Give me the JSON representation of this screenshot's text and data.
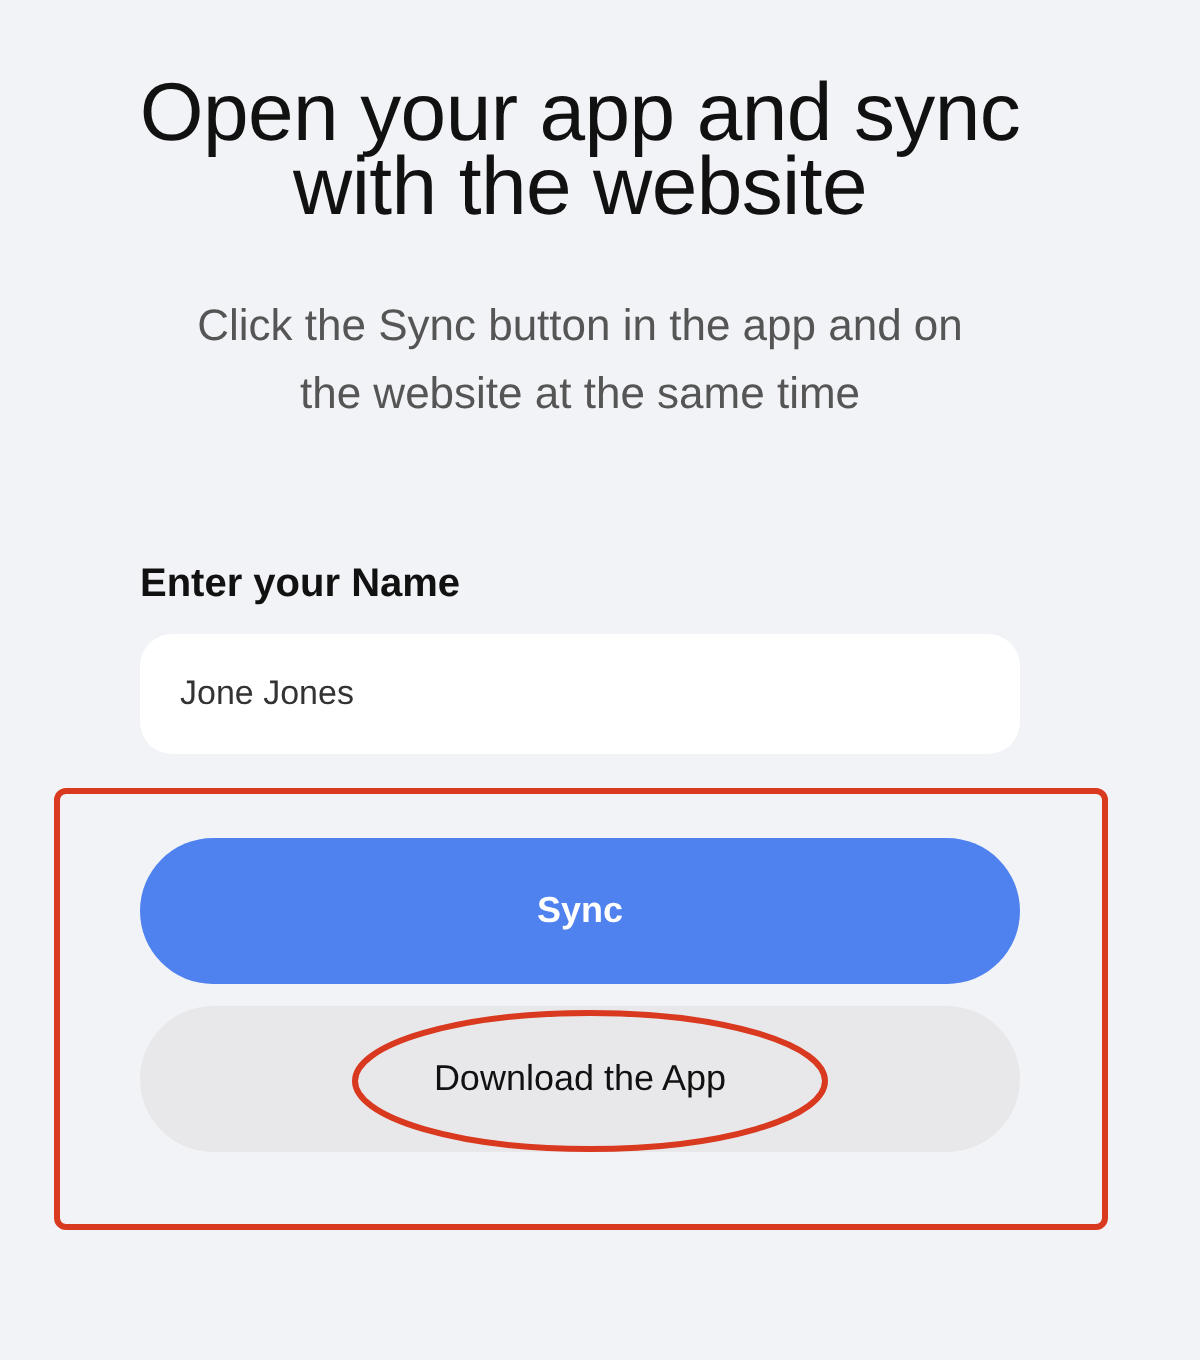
{
  "heading": {
    "title_lines": [
      "Open your app and sync",
      "with the website"
    ],
    "subtitle_lines": [
      "Click the Sync button in the app and on",
      "the website at the same time"
    ]
  },
  "form": {
    "label": "Enter your Name",
    "name_field": {
      "value": "Jone Jones"
    }
  },
  "actions": {
    "framed": true,
    "buttons": [
      {
        "label": "Sync",
        "kind": "primary",
        "circled": false
      },
      {
        "label": "Download the App",
        "kind": "secondary",
        "circled": true
      }
    ]
  }
}
